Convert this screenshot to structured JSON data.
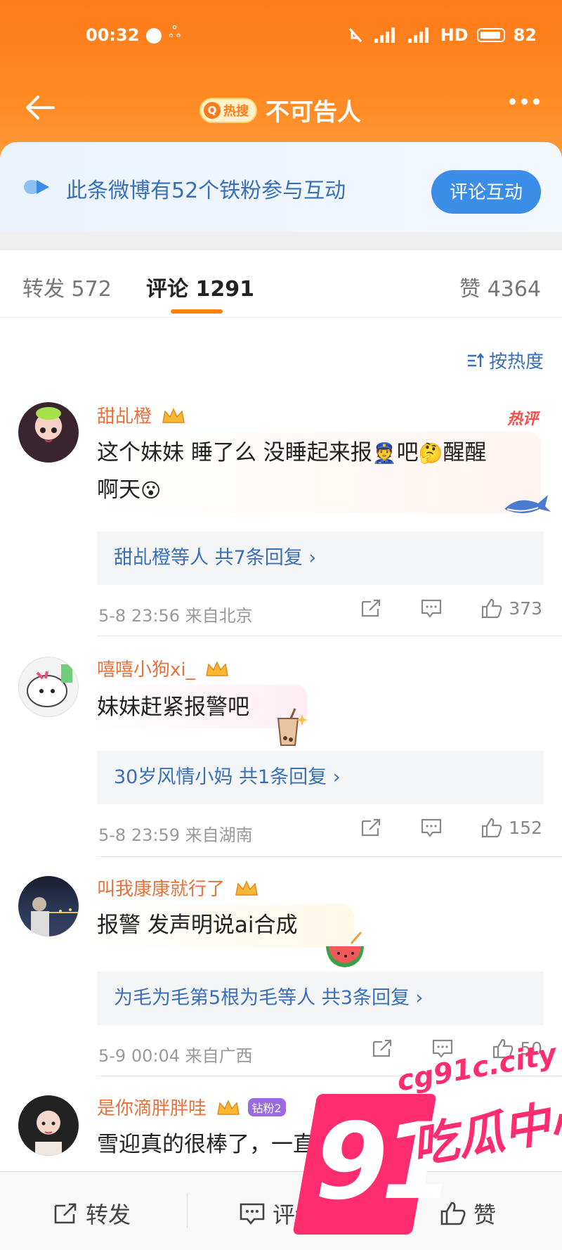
{
  "status_bar": {
    "time": "00:32",
    "network": "HD",
    "battery": "82"
  },
  "nav": {
    "hot_badge": "热搜",
    "title": "不可告人"
  },
  "fan_card": {
    "text": "此条微博有52个铁粉参与互动",
    "button": "评论互动"
  },
  "tabs": {
    "repost": "转发 572",
    "comments": "评论 1291",
    "likes": "赞 4364"
  },
  "sort": {
    "label": "按热度"
  },
  "comments": [
    {
      "user": "甜乩橙",
      "hot_label": "热评",
      "text_line1": "这个妹妹 睡了么 没睡起来报",
      "text_line1_end": "吧",
      "text_line1_tail": "醒醒",
      "text_line2": "啊天",
      "replies": "甜乩橙等人  共7条回复 ›",
      "time": "5-8 23:56  来自北京",
      "likes": "373"
    },
    {
      "user": "嘻嘻小狗xi_",
      "text": "妹妹赶紧报警吧",
      "replies": "30岁风情小妈  共1条回复 ›",
      "time": "5-8 23:59  来自湖南",
      "likes": "152"
    },
    {
      "user": "叫我康康就行了",
      "text": "报警 发声明说ai合成",
      "replies": "为毛为毛第5根为毛等人  共3条回复 ›",
      "time": "5-9 00:04  来自广西",
      "likes": "50"
    },
    {
      "user": "是你滴胖胖哇",
      "fan_level": "钻粉2",
      "text": "雪迎真的很棒了，一直想办法的致"
    }
  ],
  "bottom_bar": {
    "repost": "转发",
    "comment": "评论",
    "like": "赞"
  },
  "watermark": {
    "number": "91",
    "url": "cg91c.city",
    "name": "吃瓜中心"
  },
  "colors": {
    "header_orange": "#ff7a1a",
    "link_blue": "#3a6fb8",
    "username_orange": "#e7713b",
    "watermark_pink": "#ff2d6f"
  }
}
